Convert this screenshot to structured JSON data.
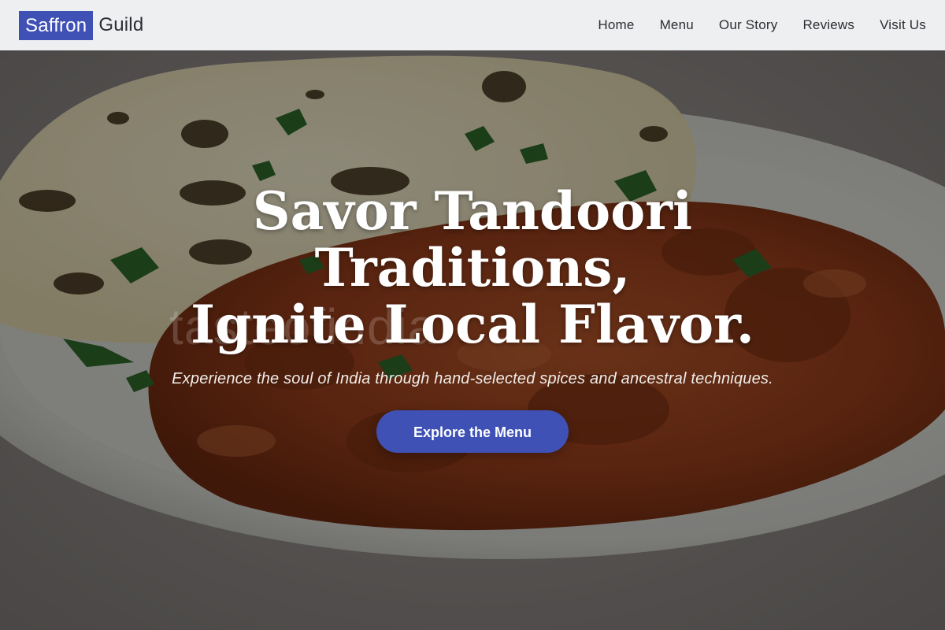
{
  "brand": {
    "highlight": "Saffron",
    "rest": "Guild"
  },
  "nav": {
    "items": [
      "Home",
      "Menu",
      "Our Story",
      "Reviews",
      "Visit Us"
    ]
  },
  "hero": {
    "title_lines": [
      "Savor Tandoori",
      "Traditions,",
      "Ignite Local Flavor."
    ],
    "subtitle": "Experience the soul of India through hand-selected spices and ancestral techniques.",
    "cta_label": "Explore the Menu",
    "watermark": "tasteofindia",
    "background": "food-photo-naan-and-curry"
  },
  "colors": {
    "accent": "#3f51b5",
    "header_bg": "#eeeff0",
    "nav_text": "#2b2d33"
  }
}
